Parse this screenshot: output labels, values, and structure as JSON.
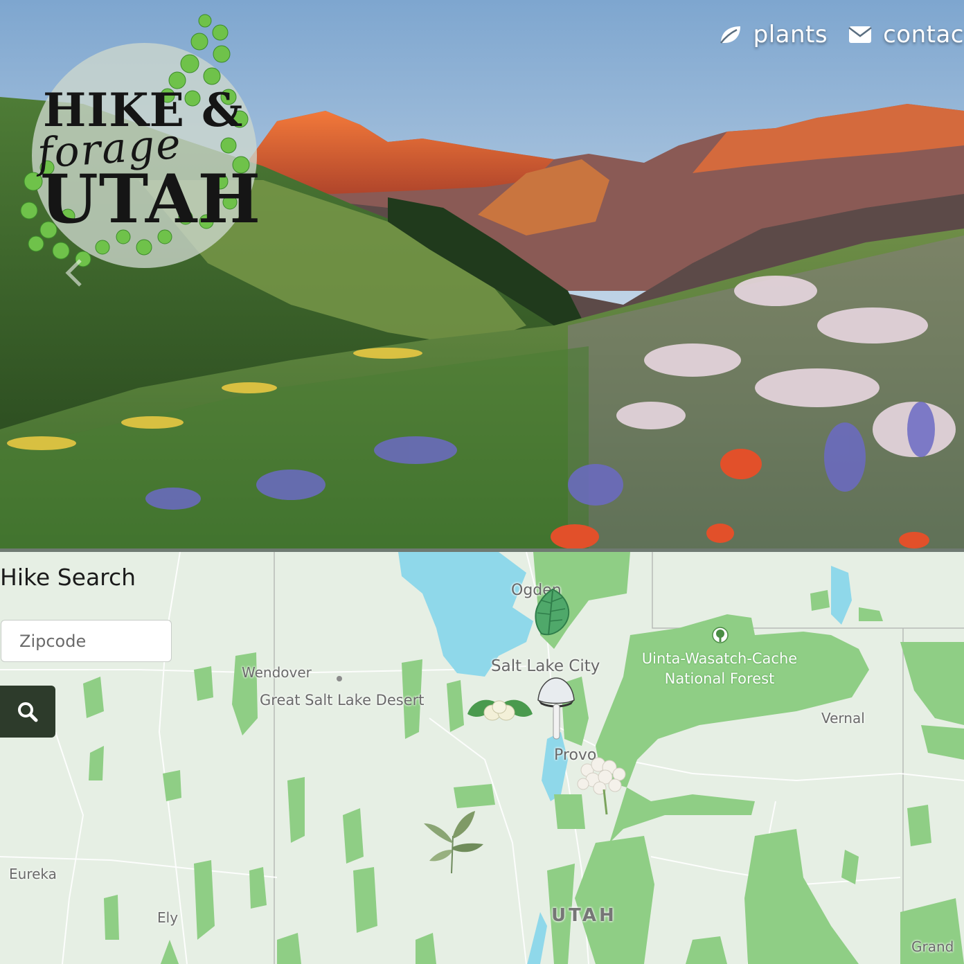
{
  "nav": {
    "items": [
      {
        "label": "plants",
        "icon": "leaf-icon"
      },
      {
        "label": "contac",
        "icon": "envelope-icon"
      }
    ]
  },
  "logo": {
    "line1": "HIKE &",
    "line2": "forage",
    "line3": "UTAH"
  },
  "hero": {
    "prev_icon": "chevron-left-icon"
  },
  "search": {
    "title": "Hike Search",
    "zip_placeholder": "Zipcode",
    "zip_value": "",
    "button_icon": "search-icon"
  },
  "map": {
    "cities": [
      "Ogden",
      "Salt Lake City",
      "Wendover",
      "Great Salt Lake Desert",
      "Provo",
      "Vernal",
      "Eureka",
      "Ely",
      "Grand"
    ],
    "forest_lines": [
      "Uinta-Wasatch-Cache",
      "National Forest"
    ],
    "state": "UTAH",
    "markers": [
      "leaf-marker-icon",
      "mulberry-marker-icon",
      "mushroom-marker-icon",
      "yarrow-marker-icon",
      "sage-marker-icon",
      "park-tree-icon"
    ]
  },
  "colors": {
    "search_button": "#2d3b2b",
    "map_land": "#e6efe4",
    "map_forest": "#8fce85",
    "map_water": "#8fd8ea"
  }
}
